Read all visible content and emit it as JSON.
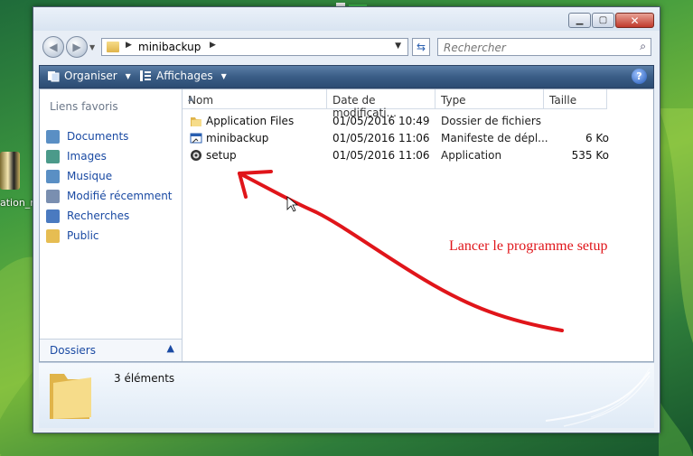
{
  "desktop": {
    "icon_label": "ation_m"
  },
  "window": {
    "address": {
      "crumb": "minibackup"
    },
    "search": {
      "placeholder": "Rechercher"
    },
    "toolbar": {
      "organize_label": "Organiser",
      "views_label": "Affichages",
      "help_glyph": "?"
    },
    "nav_pane": {
      "heading": "Liens favoris",
      "items": [
        {
          "label": "Documents",
          "icon": "documents-icon",
          "color": "#5a8fc4"
        },
        {
          "label": "Images",
          "icon": "images-icon",
          "color": "#4b9a8a"
        },
        {
          "label": "Musique",
          "icon": "music-icon",
          "color": "#5a8fc4"
        },
        {
          "label": "Modifié récemment",
          "icon": "recent-icon",
          "color": "#7a8fb0"
        },
        {
          "label": "Recherches",
          "icon": "search-folder-icon",
          "color": "#4a7ac0"
        },
        {
          "label": "Public",
          "icon": "public-folder-icon",
          "color": "#e6bd52"
        }
      ],
      "folders_label": "Dossiers"
    },
    "columns": {
      "name": "Nom",
      "date": "Date de modificati...",
      "type": "Type",
      "size": "Taille"
    },
    "files": [
      {
        "name": "Application Files",
        "date": "01/05/2016 10:49",
        "type": "Dossier de fichiers",
        "size": "",
        "icon": "folder-icon"
      },
      {
        "name": "minibackup",
        "date": "01/05/2016 11:06",
        "type": "Manifeste de dépl...",
        "size": "6 Ko",
        "icon": "manifest-icon"
      },
      {
        "name": "setup",
        "date": "01/05/2016 11:06",
        "type": "Application",
        "size": "535 Ko",
        "icon": "setup-app-icon"
      }
    ],
    "details": {
      "count": "3 éléments"
    }
  },
  "annotation": {
    "text": "Lancer le programme setup",
    "color": "#e0151a"
  }
}
